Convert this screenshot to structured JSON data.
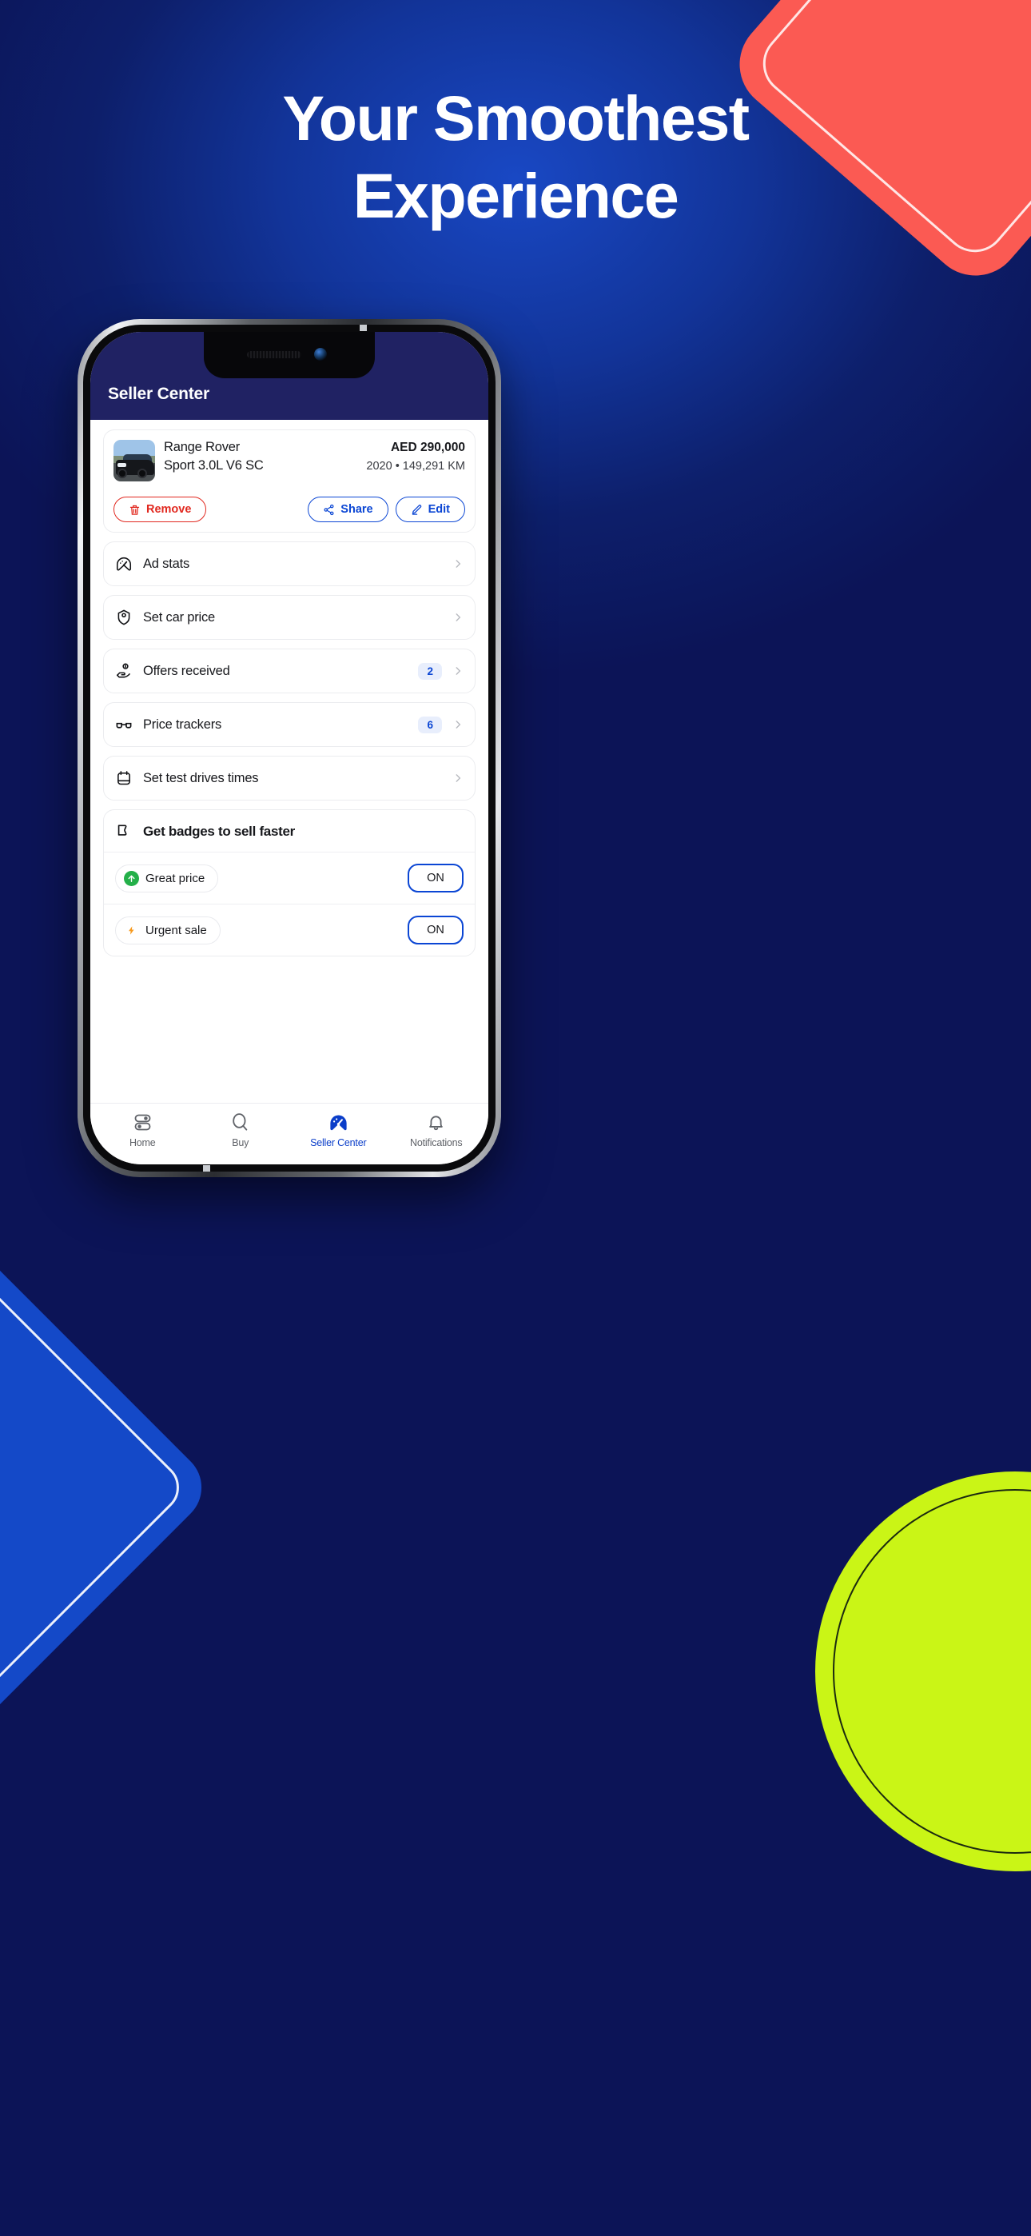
{
  "promo": {
    "headline_lines": [
      "Your Smoothest",
      "Experience"
    ],
    "colors": {
      "bg_deep_navy": "#0d1452",
      "bg_blue_glow": "#1948c4",
      "shape_coral": "#fb5a53",
      "shape_blue": "#1449c8",
      "shape_lime": "#caf516"
    }
  },
  "app": {
    "header": {
      "title": "Seller Center",
      "bg": "#202263"
    },
    "car": {
      "thumb_icon": "car-photo",
      "name_line1": "Range Rover",
      "name_line2": "Sport 3.0L V6 SC",
      "price": "AED 290,000",
      "meta": "2020 • 149,291 KM",
      "actions": [
        {
          "label": "Remove",
          "icon": "trash-icon",
          "color": "#e1281f"
        },
        {
          "label": "Share",
          "icon": "share-icon",
          "color": "#0b46d4"
        },
        {
          "label": "Edit",
          "icon": "pencil-icon",
          "color": "#0b46d4"
        }
      ]
    },
    "menu_rows": [
      {
        "label": "Ad stats",
        "icon": "speedometer-icon",
        "badge": ""
      },
      {
        "label": "Set car price",
        "icon": "price-tag-icon",
        "badge": ""
      },
      {
        "label": "Offers received",
        "icon": "hand-coin-icon",
        "badge": "2"
      },
      {
        "label": "Price trackers",
        "icon": "glasses-icon",
        "badge": "6"
      },
      {
        "label": "Set test drives times",
        "icon": "calendar-icon",
        "badge": ""
      }
    ],
    "badges_section": {
      "title": "Get badges to sell faster",
      "icon": "banner-badge-icon",
      "rows": [
        {
          "label": "Great price",
          "icon": "green-arrow-up-icon",
          "icon_color": "#24b049",
          "state": "ON"
        },
        {
          "label": "Urgent sale",
          "icon": "orange-bolt-icon",
          "icon_color": "#f79a1e",
          "state": "ON"
        }
      ]
    },
    "bottom_nav": [
      {
        "label": "Home",
        "icon": "sliders-icon",
        "active": false
      },
      {
        "label": "Buy",
        "icon": "search-icon",
        "active": false
      },
      {
        "label": "Seller Center",
        "icon": "speedometer-filled-icon",
        "active": true
      },
      {
        "label": "Notifications",
        "icon": "bell-icon",
        "active": false
      }
    ],
    "accent_color": "#0b46d4",
    "badge_bg": "#e8eefc"
  }
}
